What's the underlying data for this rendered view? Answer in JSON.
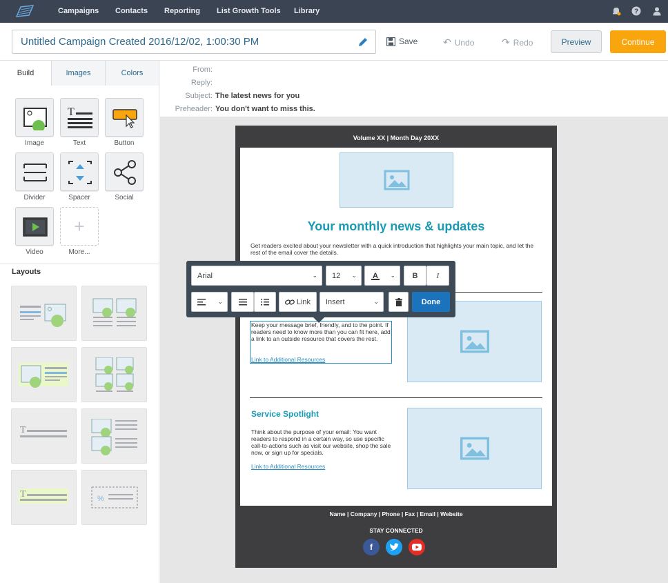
{
  "nav": {
    "items": [
      "Campaigns",
      "Contacts",
      "Reporting",
      "List Growth Tools",
      "Library"
    ],
    "icons": [
      "bell-icon",
      "help-icon",
      "user-icon"
    ]
  },
  "titlebar": {
    "campaign_name": "Untitled Campaign Created 2016/12/02, 1:00:30 PM",
    "save": "Save",
    "undo": "Undo",
    "redo": "Redo",
    "preview": "Preview",
    "continue": "Continue"
  },
  "sidebar": {
    "tabs": [
      "Build",
      "Images",
      "Colors"
    ],
    "blocks": [
      "Image",
      "Text",
      "Button",
      "Divider",
      "Spacer",
      "Social",
      "Video",
      "More..."
    ],
    "layouts_heading": "Layouts"
  },
  "header_fields": {
    "from_label": "From:",
    "reply_label": "Reply:",
    "subject_label": "Subject:",
    "subject": "The latest news for you",
    "preheader_label": "Preheader:",
    "preheader": "You don't want to miss this."
  },
  "email": {
    "top_bar": "Volume XX | Month Day 20XX",
    "headline": "Your monthly news & updates",
    "intro": "Get readers excited about your newsletter with a quick introduction that highlights your main topic, and let the rest of the email cover the details.",
    "section1_text": "Keep your message brief, friendly, and to the point. If readers need to know more than you can fit here, add a link to an outside resource that covers the rest.",
    "section1_link": "Link to Additional Resources",
    "section2_heading": "Service Spotlight",
    "section2_text": "Think about the purpose of your email: You want readers to respond in a certain way, so use specific call-to-actions such as visit our website, shop the sale now, or sign up for specials.",
    "section2_link": "Link to Additional Resources",
    "footer_links": "Name | Company | Phone | Fax | Email | Website",
    "stay_connected": "STAY CONNECTED",
    "social_icons": [
      "facebook-icon",
      "twitter-icon",
      "youtube-icon"
    ]
  },
  "toolbar": {
    "font": "Arial",
    "size": "12",
    "bold": "B",
    "italic": "I",
    "link": "Link",
    "insert": "Insert",
    "done": "Done"
  },
  "colors": {
    "nav_bg": "#3b4452",
    "accent_orange": "#f9a50e",
    "headline_teal": "#1a9bb4",
    "done_blue": "#1b72bd",
    "facebook": "#3b5998",
    "twitter": "#1da1f2",
    "youtube": "#e52d27"
  }
}
